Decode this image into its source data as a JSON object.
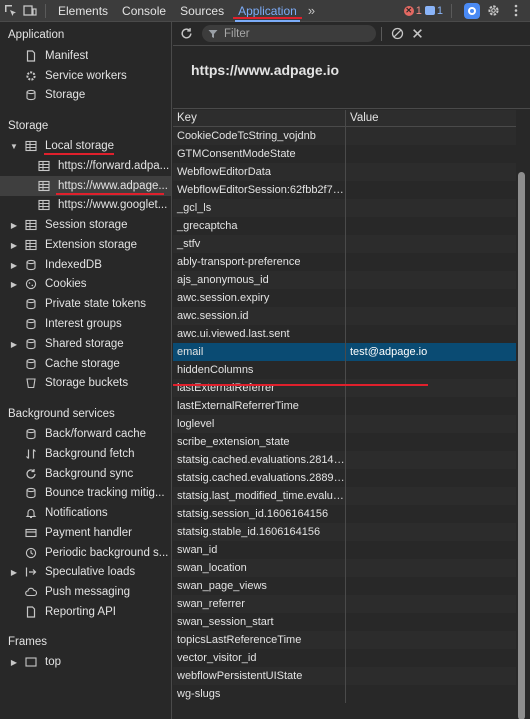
{
  "topbar": {
    "tabs": [
      "Elements",
      "Console",
      "Sources",
      "Application"
    ],
    "active_tab": "Application",
    "more": "»",
    "error_count": "1",
    "message_count": "1"
  },
  "sidebar": {
    "application_title": "Application",
    "application_items": [
      "Manifest",
      "Service workers",
      "Storage"
    ],
    "storage_title": "Storage",
    "local_storage": "Local storage",
    "local_storage_children": [
      "https://forward.adpa...",
      "https://www.adpage...",
      "https://www.googlet..."
    ],
    "storage_items": [
      "Session storage",
      "Extension storage",
      "IndexedDB",
      "Cookies",
      "Private state tokens",
      "Interest groups",
      "Shared storage",
      "Cache storage",
      "Storage buckets"
    ],
    "background_title": "Background services",
    "background_items": [
      "Back/forward cache",
      "Background fetch",
      "Background sync",
      "Bounce tracking mitig...",
      "Notifications",
      "Payment handler",
      "Periodic background s...",
      "Speculative loads",
      "Push messaging",
      "Reporting API"
    ],
    "frames_title": "Frames",
    "frames_items": [
      "top"
    ]
  },
  "main": {
    "filter_placeholder": "Filter",
    "origin": "https://www.adpage.io",
    "columns": {
      "key": "Key",
      "value": "Value"
    },
    "rows": [
      {
        "key": "CookieCodeTcString_vojdnb",
        "value": ""
      },
      {
        "key": "GTMConsentModeState",
        "value": ""
      },
      {
        "key": "WebflowEditorData",
        "value": ""
      },
      {
        "key": "WebflowEditorSession:62fbb2f74...",
        "value": ""
      },
      {
        "key": "_gcl_ls",
        "value": ""
      },
      {
        "key": "_grecaptcha",
        "value": ""
      },
      {
        "key": "_stfv",
        "value": ""
      },
      {
        "key": "ably-transport-preference",
        "value": ""
      },
      {
        "key": "ajs_anonymous_id",
        "value": ""
      },
      {
        "key": "awc.session.expiry",
        "value": ""
      },
      {
        "key": "awc.session.id",
        "value": ""
      },
      {
        "key": "awc.ui.viewed.last.sent",
        "value": ""
      },
      {
        "key": "email",
        "value": "test@adpage.io"
      },
      {
        "key": "hiddenColumns",
        "value": ""
      },
      {
        "key": "lastExternalReferrer",
        "value": ""
      },
      {
        "key": "lastExternalReferrerTime",
        "value": ""
      },
      {
        "key": "loglevel",
        "value": ""
      },
      {
        "key": "scribe_extension_state",
        "value": ""
      },
      {
        "key": "statsig.cached.evaluations.28140...",
        "value": ""
      },
      {
        "key": "statsig.cached.evaluations.28898...",
        "value": ""
      },
      {
        "key": "statsig.last_modified_time.evalua...",
        "value": ""
      },
      {
        "key": "statsig.session_id.1606164156",
        "value": ""
      },
      {
        "key": "statsig.stable_id.1606164156",
        "value": ""
      },
      {
        "key": "swan_id",
        "value": ""
      },
      {
        "key": "swan_location",
        "value": ""
      },
      {
        "key": "swan_page_views",
        "value": ""
      },
      {
        "key": "swan_referrer",
        "value": ""
      },
      {
        "key": "swan_session_start",
        "value": ""
      },
      {
        "key": "topicsLastReferenceTime",
        "value": ""
      },
      {
        "key": "vector_visitor_id",
        "value": ""
      },
      {
        "key": "webflowPersistentUIState",
        "value": ""
      },
      {
        "key": "wg-slugs",
        "value": ""
      }
    ],
    "selected_key": "email"
  }
}
